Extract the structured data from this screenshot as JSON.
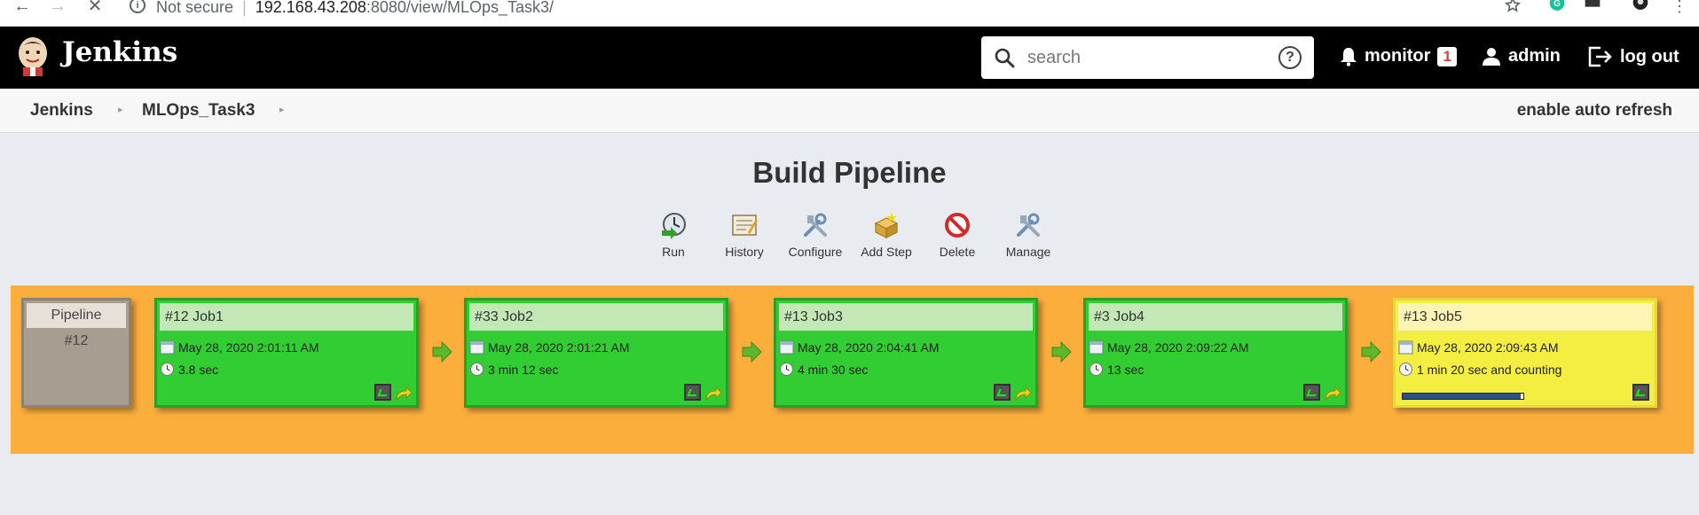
{
  "browser": {
    "security_label": "Not secure",
    "url_host": "192.168.43.208",
    "url_rest": ":8080/view/MLOps_Task3/"
  },
  "header": {
    "brand": "Jenkins",
    "search_placeholder": "search",
    "monitor_label": "monitor",
    "monitor_count": "1",
    "user_label": "admin",
    "logout_label": "log out"
  },
  "breadcrumbs": {
    "items": [
      "Jenkins",
      "MLOps_Task3"
    ],
    "auto_refresh": "enable auto refresh"
  },
  "page_title": "Build Pipeline",
  "toolbar": {
    "items": [
      {
        "label": "Run",
        "icon": "run-icon"
      },
      {
        "label": "History",
        "icon": "history-icon"
      },
      {
        "label": "Configure",
        "icon": "configure-icon"
      },
      {
        "label": "Add Step",
        "icon": "add-step-icon"
      },
      {
        "label": "Delete",
        "icon": "delete-icon"
      },
      {
        "label": "Manage",
        "icon": "manage-icon"
      }
    ]
  },
  "pipeline": {
    "head_title": "Pipeline",
    "head_number": "#12",
    "colors": {
      "success": "#32cd32",
      "running": "#f4ee42",
      "background": "#fbae3c"
    },
    "jobs": [
      {
        "title": "#12 Job1",
        "date": "May 28, 2020 2:01:11 AM",
        "duration": "3.8 sec",
        "status": "success"
      },
      {
        "title": "#33 Job2",
        "date": "May 28, 2020 2:01:21 AM",
        "duration": "3 min 12 sec",
        "status": "success"
      },
      {
        "title": "#13 Job3",
        "date": "May 28, 2020 2:04:41 AM",
        "duration": "4 min 30 sec",
        "status": "success"
      },
      {
        "title": "#3 Job4",
        "date": "May 28, 2020 2:09:22 AM",
        "duration": "13 sec",
        "status": "success"
      },
      {
        "title": "#13 Job5",
        "date": "May 28, 2020 2:09:43 AM",
        "duration": "1 min 20 sec and counting",
        "status": "running",
        "progress": 0.98
      }
    ]
  }
}
